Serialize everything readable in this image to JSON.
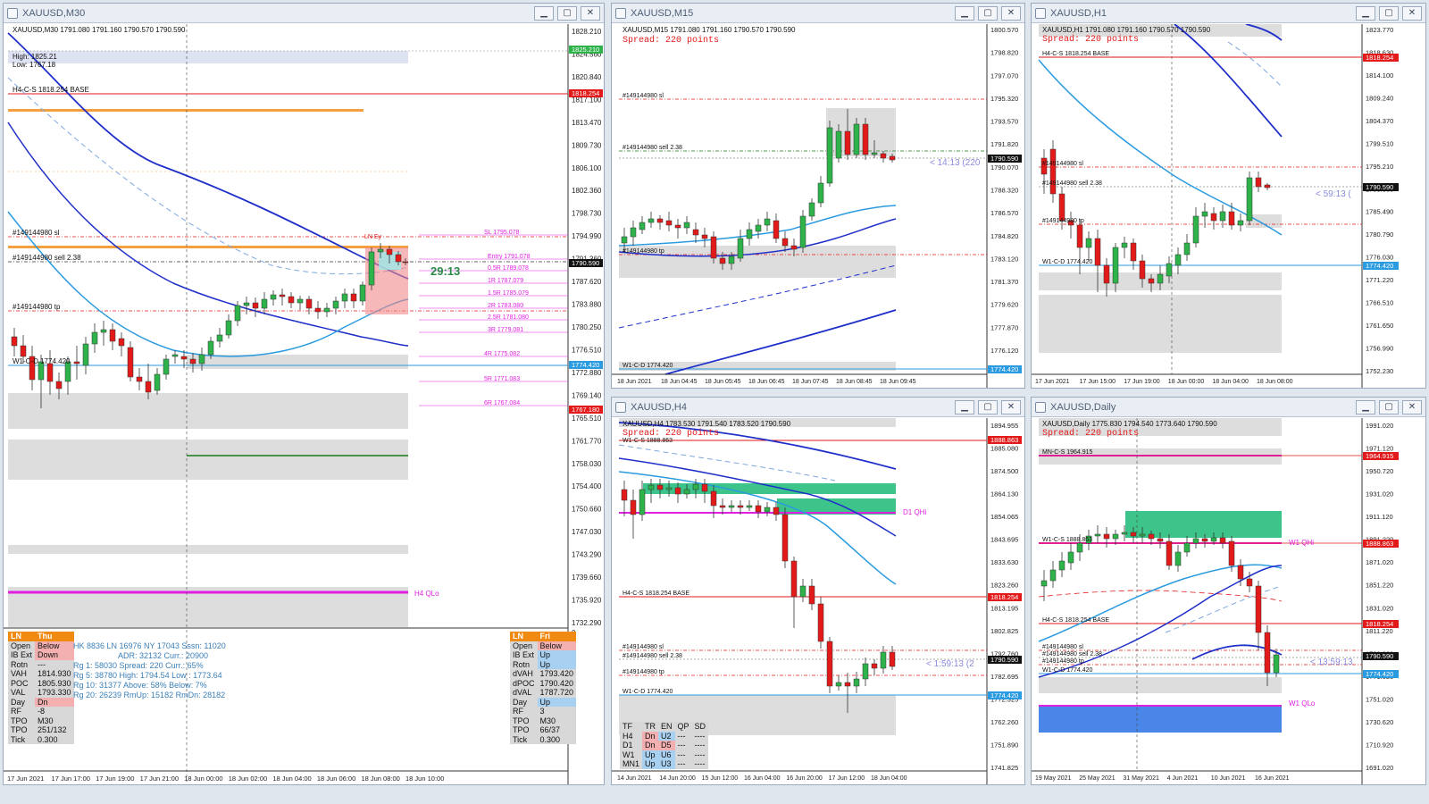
{
  "windows": {
    "m30": {
      "title": "XAUUSD,M30",
      "header": "XAUUSD,M30  1791.080 1791.160 1790.570 1790.590",
      "high": "High: 1825.21",
      "low": "Low: 1767.18",
      "labels": {
        "h4cs": "H4-C-S 1818.254 BASE",
        "sl": "#149144980 sl",
        "sell": "#149144980 sell 2.38",
        "tp": "#149144980 tp",
        "w1cd": "W1-C-D 1774.420",
        "h4qlo": "H4 QLo",
        "timer": "29:13",
        "ln": "LN Ey"
      },
      "levels": [
        "SL 1795.078",
        "Entry 1791.078",
        "0.5R 1789.078",
        "1R 1787.079",
        "1.5R 1785.079",
        "2R 1783.080",
        "2.5R 1781.080",
        "3R 1779.081",
        "4R 1775.082",
        "5R 1771.083",
        "6R 1767.084"
      ],
      "price_axis": [
        "1828.210",
        "1824.560",
        "1820.840",
        "1817.100",
        "1813.470",
        "1809.730",
        "1806.100",
        "1802.360",
        "1798.730",
        "1794.990",
        "1791.360",
        "1787.620",
        "1783.880",
        "1780.250",
        "1776.510",
        "1772.880",
        "1769.140",
        "1765.510",
        "1761.770",
        "1758.030",
        "1754.400",
        "1750.660",
        "1747.030",
        "1743.290",
        "1739.660",
        "1735.920",
        "1732.290"
      ],
      "price_tags": {
        "p1825": "1825.210",
        "p1818": "1818.254",
        "cur": "1790.590",
        "p1774": "1774.420",
        "p1767": "1767.180"
      },
      "time_axis": [
        "17 Jun 2021",
        "17 Jun 17:00",
        "17 Jun 19:00",
        "17 Jun 21:00",
        "18 Jun 00:00",
        "18 Jun 02:00",
        "18 Jun 04:00",
        "18 Jun 06:00",
        "18 Jun 08:00",
        "18 Jun 10:00"
      ],
      "sub_zero": "0"
    },
    "m15": {
      "title": "XAUUSD,M15",
      "header": "XAUUSD,M15  1791.080 1791.160 1790.570 1790.590",
      "spread": "Spread: 220 points",
      "labels": {
        "sl": "#149144980 sl",
        "sell": "#149144980 sell 2.38",
        "tp": "#149144980 tp",
        "w1cd": "W1-C-D 1774.420",
        "timer": "< 14:13 (220"
      },
      "price_axis": [
        "1800.570",
        "1798.820",
        "1797.070",
        "1795.320",
        "1793.570",
        "1791.820",
        "1790.070",
        "1788.320",
        "1786.570",
        "1784.820",
        "1783.120",
        "1781.370",
        "1779.620",
        "1777.870",
        "1776.120"
      ],
      "price_tags": {
        "cur": "1790.590",
        "p1774": "1774.420"
      },
      "time_axis": [
        "18 Jun 2021",
        "18 Jun 04:45",
        "18 Jun 05:45",
        "18 Jun 06:45",
        "18 Jun 07:45",
        "18 Jun 08:45",
        "18 Jun 09:45"
      ]
    },
    "h1": {
      "title": "XAUUSD,H1",
      "header": "XAUUSD,H1  1791.080 1791.160 1790.570 1790.590",
      "spread": "Spread: 220 points",
      "labels": {
        "h4cs": "H4-C-S 1818.254 BASE",
        "sl": "#149144980 sl",
        "sell": "#149144980 sell 2.38",
        "tp": "#149144980 tp",
        "w1cd": "W1-C-D 1774.420",
        "timer": "< 59:13 ("
      },
      "price_axis": [
        "1823.770",
        "1818.630",
        "1814.100",
        "1809.240",
        "1804.370",
        "1799.510",
        "1795.210",
        "1790.350",
        "1785.490",
        "1780.790",
        "1776.030",
        "1771.220",
        "1766.510",
        "1761.650",
        "1756.990",
        "1752.230"
      ],
      "price_tags": {
        "p1818": "1818.254",
        "cur": "1790.590",
        "p1774": "1774.420"
      },
      "time_axis": [
        "17 Jun 2021",
        "17 Jun 15:00",
        "17 Jun 19:00",
        "18 Jun 00:00",
        "18 Jun 04:00",
        "18 Jun 08:00"
      ]
    },
    "h4": {
      "title": "XAUUSD,H4",
      "header": "XAUUSD,H4  1783.530 1791.540 1783.520 1790.590",
      "spread": "Spread: 220 points",
      "labels": {
        "w1cs": "W1-C-S 1888.863",
        "d1qhi": "D1 QHi",
        "h4cs": "H4-C-S 1818.254 BASE",
        "sl": "#149144980 sl",
        "sell": "#149144980 sell 2.38",
        "tp": "#149144980 tp",
        "w1cd": "W1-C-D 1774.420",
        "timer": "< 1:59:13 (2"
      },
      "price_axis": [
        "1894.955",
        "1885.080",
        "1874.500",
        "1864.130",
        "1854.065",
        "1843.695",
        "1833.630",
        "1823.260",
        "1813.195",
        "1802.825",
        "1792.760",
        "1782.695",
        "1772.325",
        "1762.260",
        "1751.890",
        "1741.825"
      ],
      "price_tags": {
        "p1888": "1888.863",
        "p1818": "1818.254",
        "cur": "1790.590",
        "p1774": "1774.420"
      },
      "time_axis": [
        "14 Jun 2021",
        "14 Jun 20:00",
        "15 Jun 12:00",
        "16 Jun 04:00",
        "16 Jun 20:00",
        "17 Jun 12:00",
        "18 Jun 04:00"
      ],
      "trend_table": {
        "header": [
          "TF",
          "TR",
          "EN",
          "QP",
          "SD"
        ],
        "rows": [
          [
            "H4",
            "Dn",
            "U2",
            "---",
            "----"
          ],
          [
            "D1",
            "Dn",
            "D5",
            "---",
            "----"
          ],
          [
            "W1",
            "Up",
            "U6",
            "---",
            "----"
          ],
          [
            "MN1",
            "Up",
            "U3",
            "---",
            "----"
          ]
        ]
      }
    },
    "daily": {
      "title": "XAUUSD,Daily",
      "header": "XAUUSD,Daily  1775.830 1794.540 1773.640 1790.590",
      "spread": "Spread: 220 points",
      "labels": {
        "mncs": "MN-C-S 1964.915",
        "w1cs": "W1-C-S 1888.863",
        "w1qhi": "W1 QHi",
        "h4cs": "H4-C-S 1818.254 BASE",
        "sl": "#149144980 sl",
        "sell": "#149144980 sell 2.38",
        "tp": "#149144980 tp",
        "w1cd": "W1-C-D 1774.420",
        "w1qlo": "W1 QLo",
        "timer": "< 13:59:13"
      },
      "price_axis": [
        "1991.020",
        "1971.120",
        "1950.720",
        "1931.020",
        "1911.120",
        "1891.220",
        "1871.020",
        "1851.220",
        "1831.020",
        "1811.220",
        "1790.820",
        "1771.020",
        "1751.020",
        "1730.620",
        "1710.920",
        "1691.020"
      ],
      "price_tags": {
        "p1964": "1964.915",
        "p1888": "1888.863",
        "p1818": "1818.254",
        "cur": "1790.590",
        "p1774": "1774.420"
      },
      "time_axis": [
        "19 May 2021",
        "25 May 2021",
        "31 May 2021",
        "4 Jun 2021",
        "10 Jun 2021",
        "16 Jun 2021"
      ]
    }
  },
  "session_left": {
    "header": [
      "LN",
      "Thu"
    ],
    "rows": [
      [
        "Open",
        "Below"
      ],
      [
        "IB Ext",
        "Down"
      ],
      [
        "Rotn",
        "---"
      ],
      [
        "VAH",
        "1814.930"
      ],
      [
        "POC",
        "1805.930"
      ],
      [
        "VAL",
        "1793.330"
      ],
      [
        "Day",
        "Dn"
      ],
      [
        "RF",
        "-8"
      ],
      [
        "TPO",
        "M30"
      ],
      [
        "TPO",
        "251/132"
      ],
      [
        "Tick",
        "0.300"
      ]
    ]
  },
  "session_right": {
    "header": [
      "LN",
      "Fri"
    ],
    "rows": [
      [
        "Open",
        "Below"
      ],
      [
        "IB Ext",
        "Up"
      ],
      [
        "Rotn",
        "Up"
      ],
      [
        "dVAH",
        "1793.420"
      ],
      [
        "dPOC",
        "1790.420"
      ],
      [
        "dVAL",
        "1787.720"
      ],
      [
        "Day",
        "Up"
      ],
      [
        "RF",
        "3"
      ],
      [
        "TPO",
        "M30"
      ],
      [
        "TPO",
        "66/37"
      ],
      [
        "Tick",
        "0.300"
      ]
    ]
  },
  "stats": {
    "line1": "HK 8836  LN  16976  NY 17043   Sssn: 11020",
    "line2": "ADR:   32132  Curr.: 20900",
    "line3": "Rg  1:  58030  Spread: 220     Curr.:  65%",
    "line4": "Rg  5:  38780  High:  1794.54  Low : 1773.64",
    "line5": "Rg 10: 31377  Above: 58%    Below:   7%",
    "line6": "Rg 20: 26239  RmUp: 15182   RmDn: 28182"
  },
  "colors": {
    "bull": "#2db34a",
    "bear": "#e31a1a",
    "ma_dark": "#1f2fc9",
    "ma_light": "#2a9be0",
    "zone": "#dddddd",
    "green_zone": "#3cc48a",
    "magenta": "#e020e0",
    "blue_zone": "#4a86e8"
  }
}
